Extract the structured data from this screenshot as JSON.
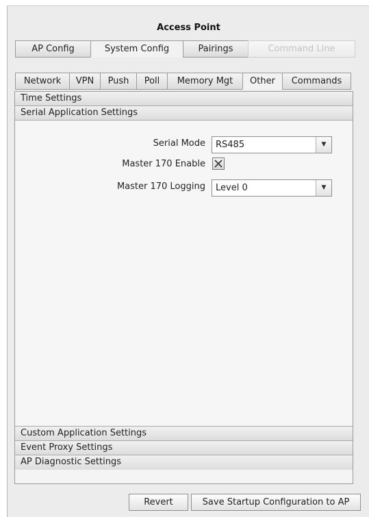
{
  "window": {
    "title": "Access Point"
  },
  "top_tabs": [
    {
      "label": "AP Config"
    },
    {
      "label": "System Config"
    },
    {
      "label": "Pairings"
    },
    {
      "label": "Command Line"
    }
  ],
  "sub_tabs": [
    {
      "label": "Network"
    },
    {
      "label": "VPN"
    },
    {
      "label": "Push"
    },
    {
      "label": "Poll"
    },
    {
      "label": "Memory Mgt"
    },
    {
      "label": "Other"
    },
    {
      "label": "Commands"
    }
  ],
  "sections": {
    "time": "Time Settings",
    "serial": "Serial Application Settings",
    "custom": "Custom Application Settings",
    "event_proxy": "Event Proxy Settings",
    "diagnostic": "AP Diagnostic Settings"
  },
  "serial_settings": {
    "serial_mode": {
      "label": "Serial Mode",
      "value": "RS485"
    },
    "master_enable": {
      "label": "Master 170 Enable",
      "checked": true
    },
    "master_logging": {
      "label": "Master 170 Logging",
      "value": "Level 0"
    }
  },
  "buttons": {
    "revert": "Revert",
    "save": "Save Startup Configuration to AP"
  },
  "icons": {
    "dropdown": "chevron-down-icon",
    "check": "x-check-icon"
  }
}
